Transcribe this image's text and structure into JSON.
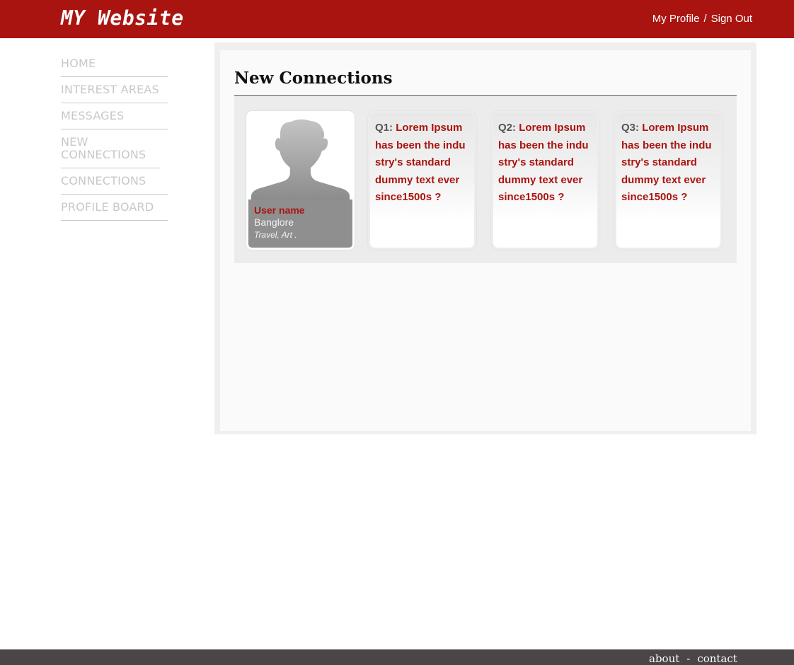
{
  "header": {
    "logo": "MY Website",
    "links": {
      "profile": "My Profile",
      "separator": "/",
      "signout": "Sign Out"
    }
  },
  "sidebar": {
    "items": [
      {
        "label": "HOME"
      },
      {
        "label": "INTEREST AREAS"
      },
      {
        "label": "MESSAGES"
      },
      {
        "label": "NEW CONNECTIONS"
      },
      {
        "label": "CONNECTIONS"
      },
      {
        "label": "PROFILE BOARD"
      }
    ]
  },
  "main": {
    "title": "New Connections",
    "profile": {
      "name": "User name",
      "city": "Banglore",
      "interests": "Travel, Art ."
    },
    "questions": [
      {
        "label": "Q1:",
        "text": "Lorem Ipsum has been the indu stry's standard dummy text ever since1500s ?"
      },
      {
        "label": "Q2:",
        "text": "Lorem Ipsum has been the indu stry's standard dummy text ever since1500s ?"
      },
      {
        "label": "Q3:",
        "text": "Lorem Ipsum has been the indu stry's standard dummy text ever since1500s ?"
      }
    ]
  },
  "footer": {
    "about": "about",
    "separator": "-",
    "contact": "contact"
  },
  "colors": {
    "brand": "#aa1410",
    "footer": "#4a4546",
    "sidebar_text": "#c8c8c8"
  }
}
